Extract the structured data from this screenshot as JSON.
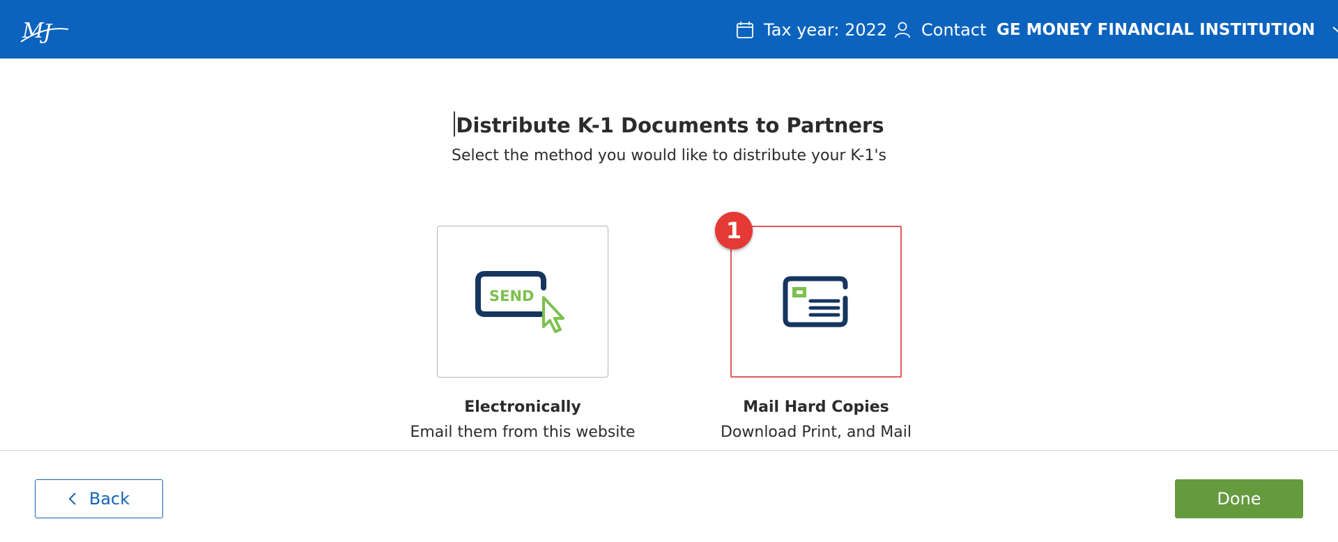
{
  "header": {
    "logo_icon": "mj-logo-icon",
    "tax_year_icon": "calendar-icon",
    "tax_year_label": "Tax year: 2022",
    "contact_icon": "user-icon",
    "contact_label": "Contact",
    "org_name": "GE MONEY FINANCIAL INSTITUTION",
    "org_dropdown_icon": "chevron-down-icon",
    "background_color": "#0b63be"
  },
  "main": {
    "title": "Distribute K-1 Documents to Partners",
    "subtitle": "Select the method you would like to distribute your K-1's",
    "options": [
      {
        "icon": "send-click-icon",
        "icon_text": "SEND",
        "title": "Electronically",
        "description": "Email them from this website"
      },
      {
        "icon": "mail-card-icon",
        "title": "Mail Hard Copies",
        "description": "Download Print, and Mail"
      }
    ],
    "highlight_badge": "1"
  },
  "footer": {
    "back_icon": "chevron-left-icon",
    "back_label": "Back",
    "done_label": "Done",
    "done_color": "#659a3f"
  }
}
